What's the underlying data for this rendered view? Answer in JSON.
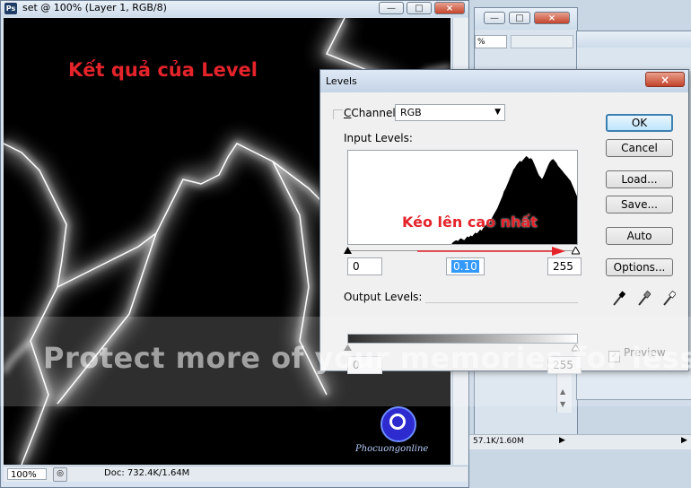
{
  "document_window": {
    "title": "set @ 100% (Layer 1, RGB/8)",
    "app_icon": "Ps",
    "zoom": "100%",
    "doc_info": "Doc: 732.4K/1.64M",
    "overlay_caption": "Kết quả của Level",
    "watermark_site": "Phocuongonline"
  },
  "background_windows": {
    "zoom_value": "%",
    "status_info": "57.1K/1.60M"
  },
  "levels_dialog": {
    "title": "Levels",
    "close_symbol": "x",
    "channel_label": "Channel:",
    "channel_value": "RGB",
    "input_levels_label": "Input Levels:",
    "input_black": "0",
    "input_gamma": "0.10",
    "input_white": "255",
    "output_levels_label": "Output Levels:",
    "output_black": "0",
    "output_white": "255",
    "buttons": {
      "ok": "OK",
      "cancel": "Cancel",
      "load": "Load...",
      "save": "Save...",
      "auto": "Auto",
      "options": "Options..."
    },
    "preview_label": "Preview",
    "preview_checked": true,
    "annotation": "Kéo lên cao nhất",
    "accent_color": "#e5232b",
    "histogram": [
      0,
      0,
      0,
      0,
      0,
      0,
      0,
      0,
      0,
      0,
      0,
      0,
      0,
      0,
      0,
      0,
      0,
      0,
      0,
      0,
      0,
      0,
      0,
      0,
      0,
      0,
      0,
      0,
      0,
      0,
      0,
      0,
      0,
      0,
      0,
      0,
      0,
      0,
      0,
      0,
      0,
      0,
      0,
      0,
      0,
      0,
      0,
      0,
      0,
      0,
      0,
      0,
      0,
      0,
      0,
      0,
      0,
      0,
      0,
      0,
      0,
      0,
      0,
      0,
      0,
      0,
      2,
      3,
      4,
      3,
      5,
      6,
      5,
      4,
      6,
      8,
      7,
      9,
      8,
      10,
      12,
      11,
      13,
      15,
      14,
      17,
      19,
      21,
      20,
      23,
      26,
      29,
      32,
      35,
      38,
      42,
      46,
      50,
      55,
      58,
      62,
      66,
      70,
      74,
      78,
      80,
      83,
      85,
      87,
      86,
      88,
      90,
      92,
      91,
      89,
      90,
      88,
      84,
      80,
      76,
      72,
      70,
      68,
      71,
      75,
      79,
      83,
      86,
      88,
      89,
      87,
      85,
      82,
      80,
      78,
      76,
      74,
      72,
      70,
      68,
      66,
      62,
      58,
      54,
      50
    ]
  },
  "watermark": {
    "text": "Protect more of your memories for less!"
  }
}
